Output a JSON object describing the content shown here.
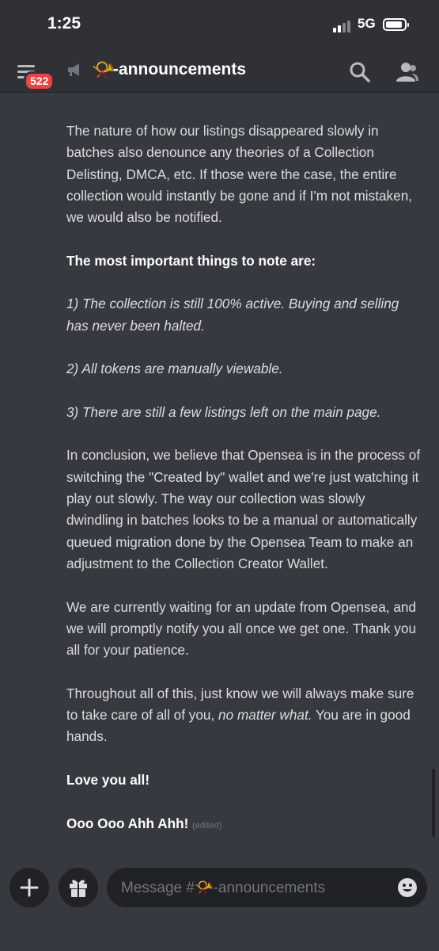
{
  "status_bar": {
    "time": "1:25",
    "network": "5G",
    "battery_level": 0.8
  },
  "header": {
    "unread_badge": "522",
    "channel_emoji": "📯",
    "channel_name": "-announcements",
    "icons": {
      "menu": "hamburger-icon",
      "channel_type": "megaphone-icon",
      "search": "search-icon",
      "members": "members-icon"
    }
  },
  "message": {
    "p1": "The nature of how our listings disappeared slowly in batches also denounce any theories of a Collection Delisting, DMCA, etc. If those were the case, the entire collection would instantly be gone and if I'm not mistaken, we would also be notified.",
    "important_heading": "The most important things to note are:",
    "point1": "1) The collection is still 100% active. Buying and selling has never been halted.",
    "point2": "2) All tokens are manually viewable.",
    "point3": "3) There are still a few listings left on the main page.",
    "p_conclusion": "In conclusion, we believe that Opensea is in the process of switching the \"Created by\" wallet and we're just watching it play out slowly. The way our collection was slowly dwindling in batches looks to be a manual or automatically queued migration done by the Opensea Team to make an adjustment to the Collection Creator Wallet.",
    "p_waiting": "We are currently waiting for an update from Opensea, and we will promptly notify you all once we get one. Thank you all for your patience.",
    "p_through_a": "Throughout all of this, just know we will always make sure to take care of all of you, ",
    "p_through_ital": "no matter what.",
    "p_through_b": " You are in good hands.",
    "love": "Love you all!",
    "ooo": "Ooo Ooo Ahh Ahh!",
    "edited": "(edited)"
  },
  "composer": {
    "placeholder": "Message #📯-announcements",
    "icons": {
      "add": "plus-icon",
      "gift": "gift-icon",
      "emoji": "emoji-icon"
    }
  },
  "colors": {
    "background": "#36393f",
    "header": "#2f3136",
    "badge": "#ed4245",
    "text": "#dcddde"
  }
}
